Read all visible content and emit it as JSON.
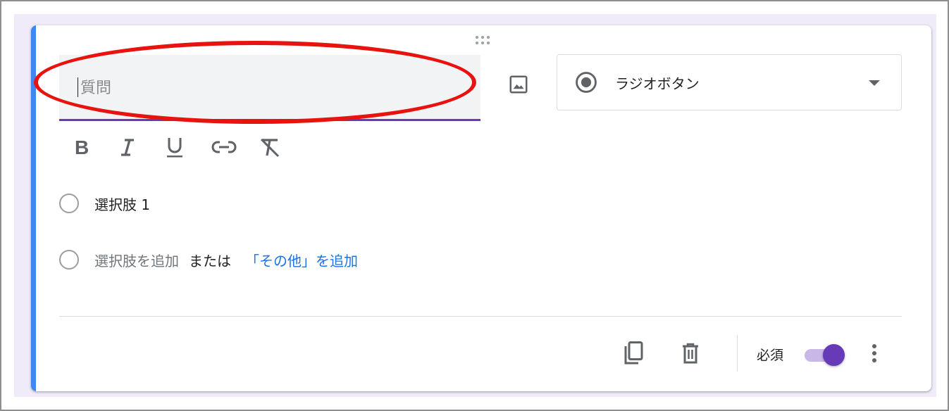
{
  "question": {
    "placeholder": "質問"
  },
  "question_type": {
    "selected": "ラジオボタン"
  },
  "format_toolbar": {
    "icons": [
      "bold-icon",
      "italic-icon",
      "underline-icon",
      "link-icon",
      "clear-format-icon"
    ]
  },
  "options": {
    "items": [
      {
        "label": "選択肢 1"
      }
    ],
    "add_option_label": "選択肢を追加",
    "or_label": "または",
    "add_other_label": "「その他」を追加"
  },
  "footer": {
    "required_label": "必須",
    "required_on": true
  },
  "colors": {
    "accent_blue": "#4285f4",
    "purple": "#673ab7",
    "link_blue": "#1a73e8",
    "annotation_red": "#e8130f",
    "background": "#efebf8"
  }
}
